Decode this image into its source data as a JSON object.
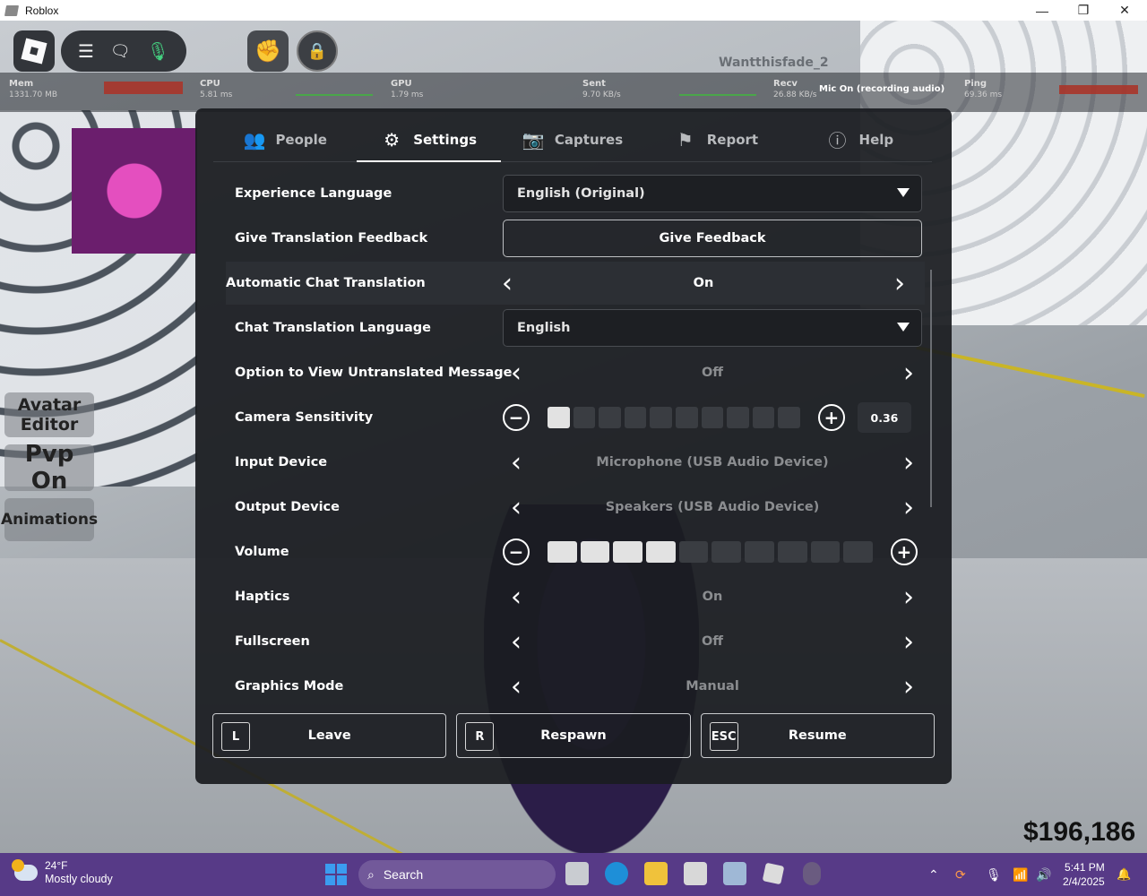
{
  "window": {
    "title": "Roblox",
    "minimize": "—",
    "maximize": "❐",
    "close": "✕"
  },
  "hud": {
    "username": "Wantthisfade_2",
    "mic_status": "Mic On (recording audio)",
    "stats": [
      {
        "name": "Mem",
        "value": "1331.70 MB"
      },
      {
        "name": "CPU",
        "value": "5.81 ms"
      },
      {
        "name": "GPU",
        "value": "1.79 ms"
      },
      {
        "name": "Sent",
        "value": "9.70 KB/s"
      },
      {
        "name": "Recv",
        "value": "26.88 KB/s"
      },
      {
        "name": "Ping",
        "value": "69.36 ms"
      }
    ],
    "side_buttons": [
      "Avatar Editor",
      "Pvp On",
      "Animations"
    ],
    "money": "$196,186",
    "icons": {
      "menu": "hamburger-icon",
      "chat": "chat-icon",
      "mic": "microphone-icon",
      "emote": "fist-icon",
      "lock": "lock-icon"
    }
  },
  "settings": {
    "tabs": [
      {
        "label": "People",
        "icon": "people-icon"
      },
      {
        "label": "Settings",
        "icon": "gear-icon",
        "active": true
      },
      {
        "label": "Captures",
        "icon": "camera-icon"
      },
      {
        "label": "Report",
        "icon": "flag-icon"
      },
      {
        "label": "Help",
        "icon": "help-icon"
      }
    ],
    "rows": {
      "experience_language": {
        "label": "Experience Language",
        "value": "English (Original)"
      },
      "translation_feedback": {
        "label": "Give Translation Feedback",
        "button": "Give Feedback"
      },
      "auto_chat_translation": {
        "label": "Automatic Chat Translation",
        "value": "On"
      },
      "chat_translation_language": {
        "label": "Chat Translation Language",
        "value": "English"
      },
      "view_untranslated": {
        "label": "Option to View Untranslated Message",
        "value": "Off"
      },
      "camera_sensitivity": {
        "label": "Camera Sensitivity",
        "value": "0.36",
        "filled_steps": 1,
        "total_steps": 10
      },
      "input_device": {
        "label": "Input Device",
        "value": "Microphone (USB Audio Device)"
      },
      "output_device": {
        "label": "Output Device",
        "value": "Speakers (USB Audio Device)"
      },
      "volume": {
        "label": "Volume",
        "filled_steps": 4,
        "total_steps": 10
      },
      "haptics": {
        "label": "Haptics",
        "value": "On"
      },
      "fullscreen": {
        "label": "Fullscreen",
        "value": "Off"
      },
      "graphics_mode": {
        "label": "Graphics Mode",
        "value": "Manual"
      }
    },
    "footer": [
      {
        "key": "L",
        "label": "Leave"
      },
      {
        "key": "R",
        "label": "Respawn"
      },
      {
        "key": "ESC",
        "label": "Resume"
      }
    ]
  },
  "taskbar": {
    "weather_temp": "24°F",
    "weather_desc": "Mostly cloudy",
    "search_placeholder": "Search",
    "time": "5:41 PM",
    "date": "2/4/2025"
  }
}
